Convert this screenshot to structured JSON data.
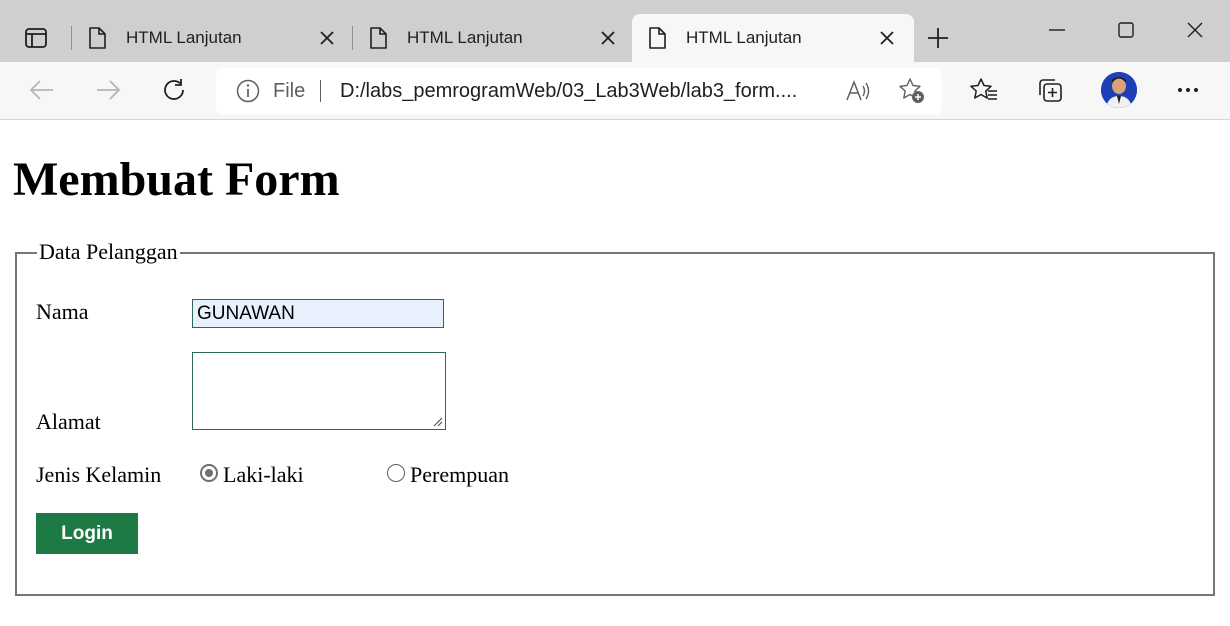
{
  "tabs": [
    {
      "title": "HTML Lanjutan",
      "active": false
    },
    {
      "title": "HTML Lanjutan",
      "active": false
    },
    {
      "title": "HTML Lanjutan",
      "active": true
    }
  ],
  "address_bar": {
    "scheme_label": "File",
    "url": "D:/labs_pemrogramWeb/03_Lab3Web/lab3_form...."
  },
  "page": {
    "heading": "Membuat Form",
    "fieldset_legend": "Data Pelanggan",
    "fields": {
      "nama_label": "Nama",
      "nama_value": "GUNAWAN",
      "alamat_label": "Alamat",
      "alamat_value": "",
      "jenis_kelamin_label": "Jenis Kelamin",
      "options": [
        {
          "label": "Laki-laki",
          "selected": true
        },
        {
          "label": "Perempuan",
          "selected": false
        }
      ]
    },
    "submit_label": "Login"
  },
  "colors": {
    "tabstrip_bg": "#cfcfcf",
    "toolbar_bg": "#f7f7f7",
    "input_autofill_bg": "#e8f0fe",
    "input_border": "#2d6a4f",
    "button_bg": "#1e7a45",
    "button_text": "#ffffff"
  },
  "icons": [
    "tab-actions-icon",
    "page-icon",
    "close-icon",
    "new-tab-icon",
    "minimize-icon",
    "maximize-icon",
    "window-close-icon",
    "back-icon",
    "forward-icon",
    "refresh-icon",
    "info-icon",
    "read-aloud-icon",
    "add-favorite-icon",
    "favorites-icon",
    "collections-icon",
    "more-icon"
  ]
}
